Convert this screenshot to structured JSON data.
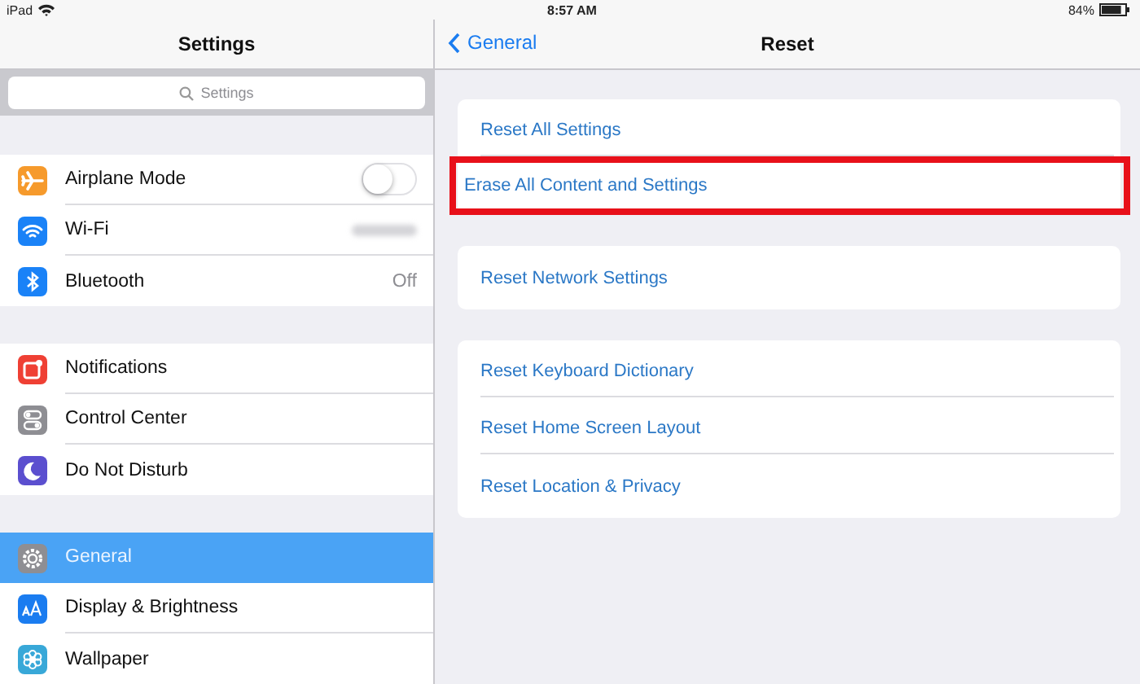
{
  "status_bar": {
    "device": "iPad",
    "time": "8:57 AM",
    "battery": "84%"
  },
  "sidebar": {
    "title": "Settings",
    "search": {
      "placeholder": "Settings"
    },
    "groups": [
      {
        "items": [
          {
            "label": "Airplane Mode",
            "color": "#f69a2c",
            "kind": "toggle",
            "on": false,
            "selected": false
          },
          {
            "label": "Wi-Fi",
            "color": "#1a82f7",
            "kind": "blurred",
            "selected": false
          },
          {
            "label": "Bluetooth",
            "color": "#1a82f7",
            "kind": "value",
            "value": "Off",
            "selected": false
          }
        ]
      },
      {
        "items": [
          {
            "label": "Notifications",
            "color": "#ef4034",
            "kind": "plain",
            "selected": false
          },
          {
            "label": "Control Center",
            "color": "#8e8e93",
            "kind": "plain",
            "selected": false
          },
          {
            "label": "Do Not Disturb",
            "color": "#5b4fcf",
            "kind": "plain",
            "selected": false
          }
        ]
      },
      {
        "items": [
          {
            "label": "General",
            "color": "#8e8e93",
            "kind": "plain",
            "selected": true
          },
          {
            "label": "Display & Brightness",
            "color": "#1a7cf0",
            "kind": "plain",
            "selected": false
          },
          {
            "label": "Wallpaper",
            "color": "#38a8d8",
            "kind": "plain",
            "selected": false
          }
        ]
      }
    ]
  },
  "detail": {
    "back": "General",
    "title": "Reset",
    "groups": [
      {
        "items": [
          {
            "label": "Reset All Settings",
            "highlighted": false
          },
          {
            "label": "Erase All Content and Settings",
            "highlighted": true
          }
        ]
      },
      {
        "items": [
          {
            "label": "Reset Network Settings",
            "highlighted": false
          }
        ]
      },
      {
        "items": [
          {
            "label": "Reset Keyboard Dictionary",
            "highlighted": false
          },
          {
            "label": "Reset Home Screen Layout",
            "highlighted": false
          },
          {
            "label": "Reset Location & Privacy",
            "highlighted": false
          }
        ]
      }
    ]
  }
}
